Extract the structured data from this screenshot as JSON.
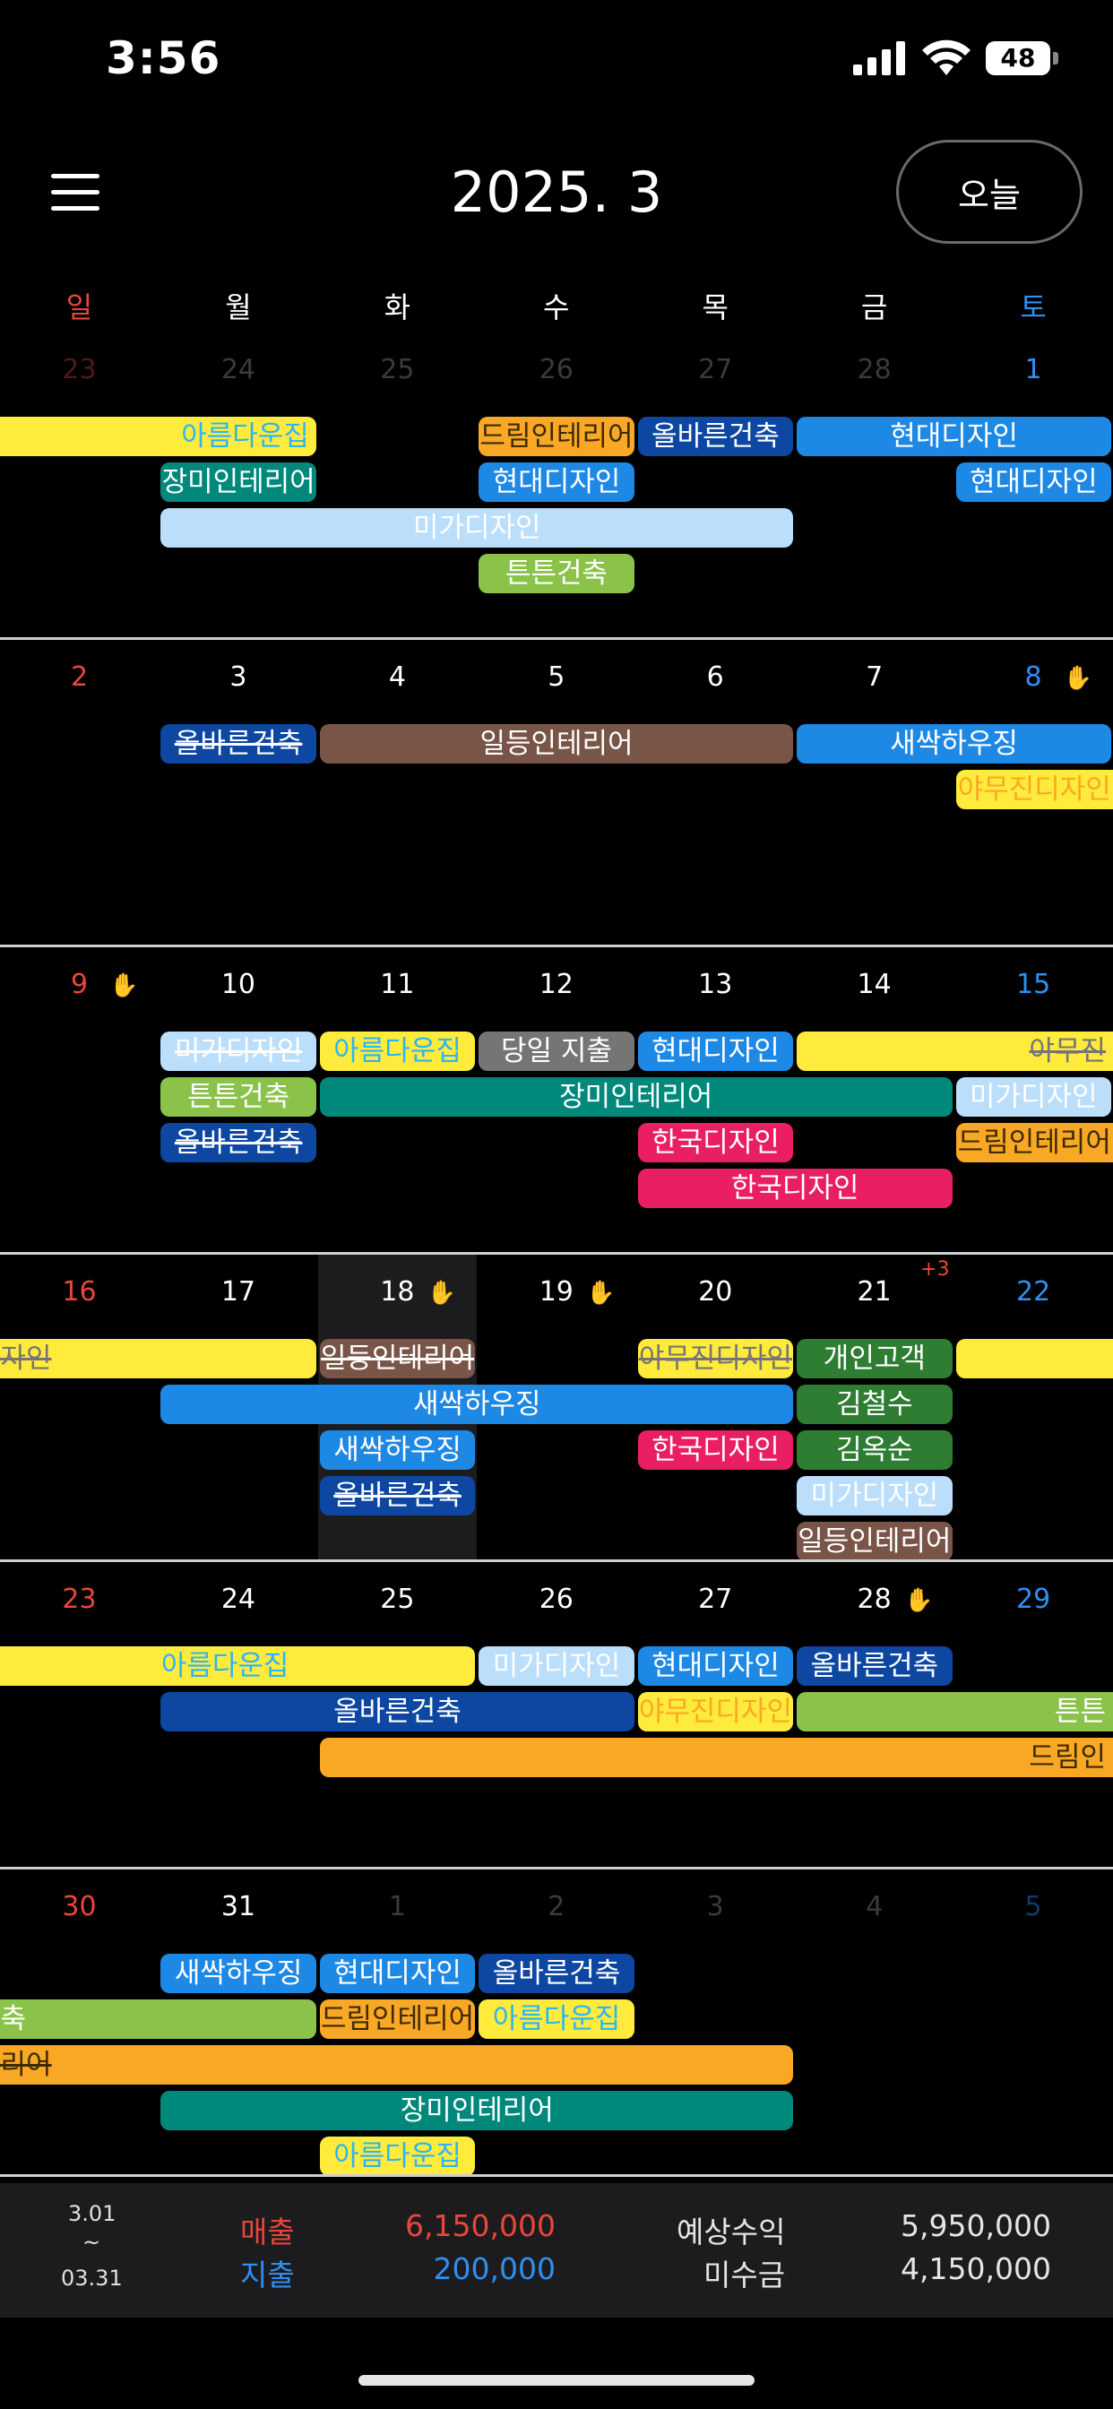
{
  "status": {
    "time": "3:56",
    "battery": "48"
  },
  "header": {
    "title": "2025. 3",
    "today_label": "오늘"
  },
  "weekdays": [
    "일",
    "월",
    "화",
    "수",
    "목",
    "금",
    "토"
  ],
  "colors": {
    "sunday": "#e8463a",
    "saturday": "#2f8ff0",
    "weekday": "#ffffff",
    "muted": "#3a3a3a",
    "yellow": "#ffeb3b",
    "teal": "#00897b",
    "light_blue": "#bbdefb",
    "orange": "#f9a825",
    "navy": "#0d47a1",
    "blue": "#1e88e5",
    "green": "#8bc34a",
    "brown": "#795548",
    "gray": "#757575",
    "pink": "#e91e63",
    "dark_green": "#2e7d32"
  },
  "weeks": [
    {
      "days": [
        {
          "n": "23",
          "muted": true
        },
        {
          "n": "24",
          "muted": true
        },
        {
          "n": "25",
          "muted": true
        },
        {
          "n": "26",
          "muted": true
        },
        {
          "n": "27",
          "muted": true
        },
        {
          "n": "28",
          "muted": true
        },
        {
          "n": "1"
        }
      ],
      "events": [
        {
          "label": "아름다운집",
          "color": "yellow",
          "text": "cyan",
          "start": 0,
          "span": 2,
          "row": 0,
          "clip": "left",
          "align": "right"
        },
        {
          "label": "드림인테리어",
          "color": "orange",
          "text": "dark",
          "start": 3,
          "span": 1,
          "row": 0
        },
        {
          "label": "올바른건축",
          "color": "navy",
          "text": "white",
          "start": 4,
          "span": 1,
          "row": 0
        },
        {
          "label": "현대디자인",
          "color": "blue",
          "text": "white",
          "start": 5,
          "span": 2,
          "row": 0
        },
        {
          "label": "장미인테리어",
          "color": "teal",
          "text": "white",
          "start": 1,
          "span": 1,
          "row": 1
        },
        {
          "label": "현대디자인",
          "color": "blue",
          "text": "white",
          "start": 3,
          "span": 1,
          "row": 1
        },
        {
          "label": "현대디자인",
          "color": "blue",
          "text": "white",
          "start": 6,
          "span": 1,
          "row": 1
        },
        {
          "label": "미가디자인",
          "color": "light_blue",
          "text": "white",
          "start": 1,
          "span": 4,
          "row": 2
        },
        {
          "label": "튼튼건축",
          "color": "green",
          "text": "white",
          "start": 3,
          "span": 1,
          "row": 3
        }
      ]
    },
    {
      "days": [
        {
          "n": "2"
        },
        {
          "n": "3"
        },
        {
          "n": "4"
        },
        {
          "n": "5"
        },
        {
          "n": "6"
        },
        {
          "n": "7"
        },
        {
          "n": "8",
          "hand": true
        }
      ],
      "events": [
        {
          "label": "올바른건축",
          "color": "navy",
          "text": "white",
          "start": 1,
          "span": 1,
          "row": 0,
          "strike": true
        },
        {
          "label": "일등인테리어",
          "color": "brown",
          "text": "white",
          "start": 2,
          "span": 3,
          "row": 0
        },
        {
          "label": "새싹하우징",
          "color": "blue",
          "text": "white",
          "start": 5,
          "span": 2,
          "row": 0
        },
        {
          "label": "야무진디자인",
          "color": "yellow",
          "text": "orange",
          "start": 6,
          "span": 1,
          "row": 1,
          "clip": "right"
        }
      ]
    },
    {
      "days": [
        {
          "n": "9",
          "hand": true
        },
        {
          "n": "10"
        },
        {
          "n": "11"
        },
        {
          "n": "12"
        },
        {
          "n": "13"
        },
        {
          "n": "14"
        },
        {
          "n": "15"
        }
      ],
      "events": [
        {
          "label": "미가디자인",
          "color": "light_blue",
          "text": "white",
          "start": 1,
          "span": 1,
          "row": 0,
          "strike": true
        },
        {
          "label": "아름다운집",
          "color": "yellow",
          "text": "cyan",
          "start": 2,
          "span": 1,
          "row": 0
        },
        {
          "label": "당일 지출",
          "color": "gray",
          "text": "white",
          "start": 3,
          "span": 1,
          "row": 0
        },
        {
          "label": "현대디자인",
          "color": "blue",
          "text": "white",
          "start": 4,
          "span": 1,
          "row": 0
        },
        {
          "label": "야무진",
          "color": "yellow",
          "text": "gray",
          "start": 5,
          "span": 2,
          "row": 0,
          "strike": true,
          "clip": "right",
          "align": "right"
        },
        {
          "label": "튼튼건축",
          "color": "green",
          "text": "white",
          "start": 1,
          "span": 1,
          "row": 1
        },
        {
          "label": "장미인테리어",
          "color": "teal",
          "text": "white",
          "start": 2,
          "span": 4,
          "row": 1
        },
        {
          "label": "미가디자인",
          "color": "light_blue",
          "text": "white",
          "start": 6,
          "span": 1,
          "row": 1
        },
        {
          "label": "올바른건축",
          "color": "navy",
          "text": "white",
          "start": 1,
          "span": 1,
          "row": 2,
          "strike": true
        },
        {
          "label": "한국디자인",
          "color": "pink",
          "text": "white",
          "start": 4,
          "span": 1,
          "row": 2
        },
        {
          "label": "드림인테리어",
          "color": "orange",
          "text": "dark",
          "start": 6,
          "span": 1,
          "row": 2,
          "clip": "right"
        },
        {
          "label": "한국디자인",
          "color": "pink",
          "text": "white",
          "start": 4,
          "span": 2,
          "row": 3
        }
      ]
    },
    {
      "days": [
        {
          "n": "16"
        },
        {
          "n": "17"
        },
        {
          "n": "18",
          "hand": true,
          "highlight": true
        },
        {
          "n": "19",
          "hand": true
        },
        {
          "n": "20"
        },
        {
          "n": "21",
          "more": "+3"
        },
        {
          "n": "22"
        }
      ],
      "events": [
        {
          "label": "디자인",
          "color": "yellow",
          "text": "gray",
          "start": 0,
          "span": 2,
          "row": 0,
          "clip": "left",
          "align": "left",
          "strike": true
        },
        {
          "label": "일등인테리어",
          "color": "brown",
          "text": "white",
          "start": 2,
          "span": 1,
          "row": 0,
          "strike": true
        },
        {
          "label": "야무진디자인",
          "color": "yellow",
          "text": "gray",
          "start": 4,
          "span": 1,
          "row": 0,
          "strike": true
        },
        {
          "label": "개인고객",
          "color": "dark_green",
          "text": "white",
          "start": 5,
          "span": 1,
          "row": 0
        },
        {
          "label": "",
          "color": "yellow",
          "text": "white",
          "start": 6,
          "span": 1,
          "row": 0,
          "clip": "right"
        },
        {
          "label": "새싹하우징",
          "color": "blue",
          "text": "white",
          "start": 1,
          "span": 4,
          "row": 1
        },
        {
          "label": "김철수",
          "color": "dark_green",
          "text": "white",
          "start": 5,
          "span": 1,
          "row": 1
        },
        {
          "label": "새싹하우징",
          "color": "blue",
          "text": "white",
          "start": 2,
          "span": 1,
          "row": 2
        },
        {
          "label": "한국디자인",
          "color": "pink",
          "text": "white",
          "start": 4,
          "span": 1,
          "row": 2
        },
        {
          "label": "김옥순",
          "color": "dark_green",
          "text": "white",
          "start": 5,
          "span": 1,
          "row": 2
        },
        {
          "label": "올바른건축",
          "color": "navy",
          "text": "white",
          "start": 2,
          "span": 1,
          "row": 3,
          "strike": true
        },
        {
          "label": "미가디자인",
          "color": "light_blue",
          "text": "white",
          "start": 5,
          "span": 1,
          "row": 3
        },
        {
          "label": "일등인테리어",
          "color": "brown",
          "text": "white",
          "start": 5,
          "span": 1,
          "row": 4
        }
      ]
    },
    {
      "days": [
        {
          "n": "23"
        },
        {
          "n": "24"
        },
        {
          "n": "25"
        },
        {
          "n": "26"
        },
        {
          "n": "27"
        },
        {
          "n": "28",
          "hand": true
        },
        {
          "n": "29"
        }
      ],
      "events": [
        {
          "label": "아름다운집",
          "color": "yellow",
          "text": "cyan",
          "start": 0,
          "span": 3,
          "row": 0,
          "clip": "left"
        },
        {
          "label": "미가디자인",
          "color": "light_blue",
          "text": "white",
          "start": 3,
          "span": 1,
          "row": 0
        },
        {
          "label": "현대디자인",
          "color": "blue",
          "text": "white",
          "start": 4,
          "span": 1,
          "row": 0
        },
        {
          "label": "올바른건축",
          "color": "navy",
          "text": "white",
          "start": 5,
          "span": 1,
          "row": 0
        },
        {
          "label": "올바른건축",
          "color": "navy",
          "text": "white",
          "start": 1,
          "span": 3,
          "row": 1
        },
        {
          "label": "야무진디자인",
          "color": "yellow",
          "text": "orange",
          "start": 4,
          "span": 1,
          "row": 1
        },
        {
          "label": "튼튼",
          "color": "green",
          "text": "white",
          "start": 5,
          "span": 2,
          "row": 1,
          "clip": "right",
          "align": "right"
        },
        {
          "label": "드림인",
          "color": "orange",
          "text": "dark",
          "start": 2,
          "span": 5,
          "row": 2,
          "clip": "right",
          "align": "right"
        }
      ]
    },
    {
      "days": [
        {
          "n": "30"
        },
        {
          "n": "31"
        },
        {
          "n": "1",
          "muted": true
        },
        {
          "n": "2",
          "muted": true
        },
        {
          "n": "3",
          "muted": true
        },
        {
          "n": "4",
          "muted": true
        },
        {
          "n": "5",
          "muted": true
        }
      ],
      "events": [
        {
          "label": "새싹하우징",
          "color": "blue",
          "text": "white",
          "start": 1,
          "span": 1,
          "row": 0
        },
        {
          "label": "현대디자인",
          "color": "blue",
          "text": "white",
          "start": 2,
          "span": 1,
          "row": 0
        },
        {
          "label": "올바른건축",
          "color": "navy",
          "text": "white",
          "start": 3,
          "span": 1,
          "row": 0
        },
        {
          "label": "건축",
          "color": "green",
          "text": "white",
          "start": 0,
          "span": 2,
          "row": 1,
          "clip": "left",
          "align": "left"
        },
        {
          "label": "드림인테리어",
          "color": "orange",
          "text": "dark",
          "start": 2,
          "span": 1,
          "row": 1
        },
        {
          "label": "아름다운집",
          "color": "yellow",
          "text": "cyan",
          "start": 3,
          "span": 1,
          "row": 1
        },
        {
          "label": "테리어",
          "color": "orange",
          "text": "dark",
          "start": 0,
          "span": 5,
          "row": 2,
          "clip": "left",
          "align": "left",
          "strike": true
        },
        {
          "label": "장미인테리어",
          "color": "teal",
          "text": "white",
          "start": 1,
          "span": 4,
          "row": 3
        },
        {
          "label": "아름다운집",
          "color": "yellow",
          "text": "cyan",
          "start": 2,
          "span": 1,
          "row": 4
        }
      ]
    }
  ],
  "footer": {
    "period_start": "3.01",
    "period_sep": "~",
    "period_end": "03.31",
    "sales_label": "매출",
    "sales_value": "6,150,000",
    "expense_label": "지출",
    "expense_value": "200,000",
    "expected_label": "예상수익",
    "expected_value": "5,950,000",
    "receivable_label": "미수금",
    "receivable_value": "4,150,000"
  }
}
